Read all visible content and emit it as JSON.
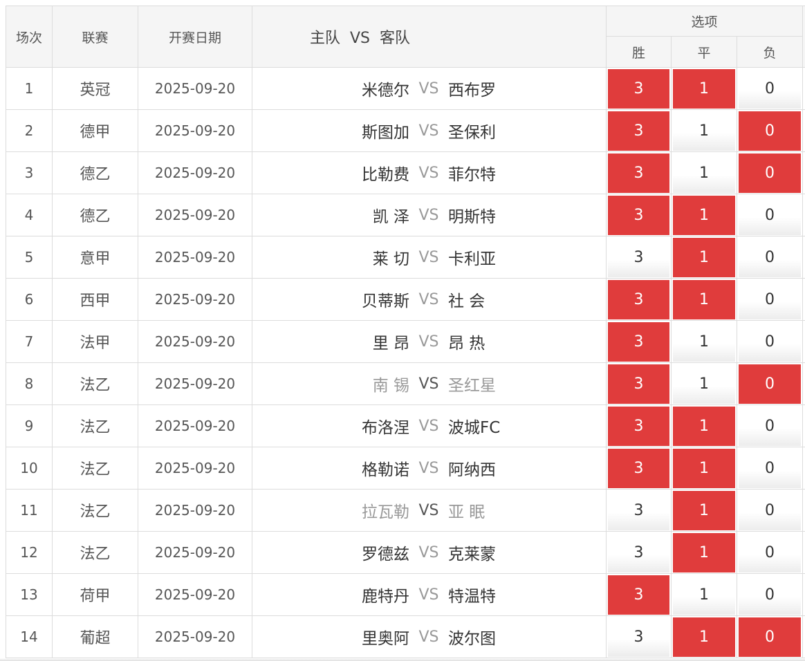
{
  "headers": {
    "index": "场次",
    "league": "联赛",
    "date": "开赛日期",
    "match": "主队  VS  客队",
    "options": "选项",
    "win": "胜",
    "draw": "平",
    "lose": "负"
  },
  "colors": {
    "selected": "#e03c3c",
    "header_bg": "#f5f5f5",
    "border": "#dcdcdc"
  },
  "rows": [
    {
      "index": "1",
      "league": "英冠",
      "date": "2025-09-20",
      "home": "米德尔",
      "vs": "VS",
      "away": "西布罗",
      "win": "3",
      "draw": "1",
      "lose": "0",
      "sel": [
        true,
        true,
        false
      ],
      "muted": false
    },
    {
      "index": "2",
      "league": "德甲",
      "date": "2025-09-20",
      "home": "斯图加",
      "vs": "VS",
      "away": "圣保利",
      "win": "3",
      "draw": "1",
      "lose": "0",
      "sel": [
        true,
        false,
        true
      ],
      "muted": false
    },
    {
      "index": "3",
      "league": "德乙",
      "date": "2025-09-20",
      "home": "比勒费",
      "vs": "VS",
      "away": "菲尔特",
      "win": "3",
      "draw": "1",
      "lose": "0",
      "sel": [
        true,
        false,
        true
      ],
      "muted": false
    },
    {
      "index": "4",
      "league": "德乙",
      "date": "2025-09-20",
      "home": "凯 泽",
      "vs": "VS",
      "away": "明斯特",
      "win": "3",
      "draw": "1",
      "lose": "0",
      "sel": [
        true,
        true,
        false
      ],
      "muted": false
    },
    {
      "index": "5",
      "league": "意甲",
      "date": "2025-09-20",
      "home": "莱 切",
      "vs": "VS",
      "away": "卡利亚",
      "win": "3",
      "draw": "1",
      "lose": "0",
      "sel": [
        false,
        true,
        false
      ],
      "muted": false
    },
    {
      "index": "6",
      "league": "西甲",
      "date": "2025-09-20",
      "home": "贝蒂斯",
      "vs": "VS",
      "away": "社 会",
      "win": "3",
      "draw": "1",
      "lose": "0",
      "sel": [
        true,
        true,
        false
      ],
      "muted": false
    },
    {
      "index": "7",
      "league": "法甲",
      "date": "2025-09-20",
      "home": "里 昂",
      "vs": "VS",
      "away": "昂 热",
      "win": "3",
      "draw": "1",
      "lose": "0",
      "sel": [
        true,
        false,
        false
      ],
      "muted": false
    },
    {
      "index": "8",
      "league": "法乙",
      "date": "2025-09-20",
      "home": "南 锡",
      "vs": "VS",
      "away": "圣红星",
      "win": "3",
      "draw": "1",
      "lose": "0",
      "sel": [
        true,
        false,
        true
      ],
      "muted": true
    },
    {
      "index": "9",
      "league": "法乙",
      "date": "2025-09-20",
      "home": "布洛涅",
      "vs": "VS",
      "away": "波城FC",
      "win": "3",
      "draw": "1",
      "lose": "0",
      "sel": [
        true,
        true,
        false
      ],
      "muted": false
    },
    {
      "index": "10",
      "league": "法乙",
      "date": "2025-09-20",
      "home": "格勒诺",
      "vs": "VS",
      "away": "阿纳西",
      "win": "3",
      "draw": "1",
      "lose": "0",
      "sel": [
        true,
        true,
        false
      ],
      "muted": false
    },
    {
      "index": "11",
      "league": "法乙",
      "date": "2025-09-20",
      "home": "拉瓦勒",
      "vs": "VS",
      "away": "亚 眠",
      "win": "3",
      "draw": "1",
      "lose": "0",
      "sel": [
        false,
        true,
        false
      ],
      "muted": true
    },
    {
      "index": "12",
      "league": "法乙",
      "date": "2025-09-20",
      "home": "罗德兹",
      "vs": "VS",
      "away": "克莱蒙",
      "win": "3",
      "draw": "1",
      "lose": "0",
      "sel": [
        false,
        true,
        false
      ],
      "muted": false
    },
    {
      "index": "13",
      "league": "荷甲",
      "date": "2025-09-20",
      "home": "鹿特丹",
      "vs": "VS",
      "away": "特温特",
      "win": "3",
      "draw": "1",
      "lose": "0",
      "sel": [
        true,
        false,
        false
      ],
      "muted": false
    },
    {
      "index": "14",
      "league": "葡超",
      "date": "2025-09-20",
      "home": "里奥阿",
      "vs": "VS",
      "away": "波尔图",
      "win": "3",
      "draw": "1",
      "lose": "0",
      "sel": [
        false,
        true,
        true
      ],
      "muted": false
    }
  ]
}
